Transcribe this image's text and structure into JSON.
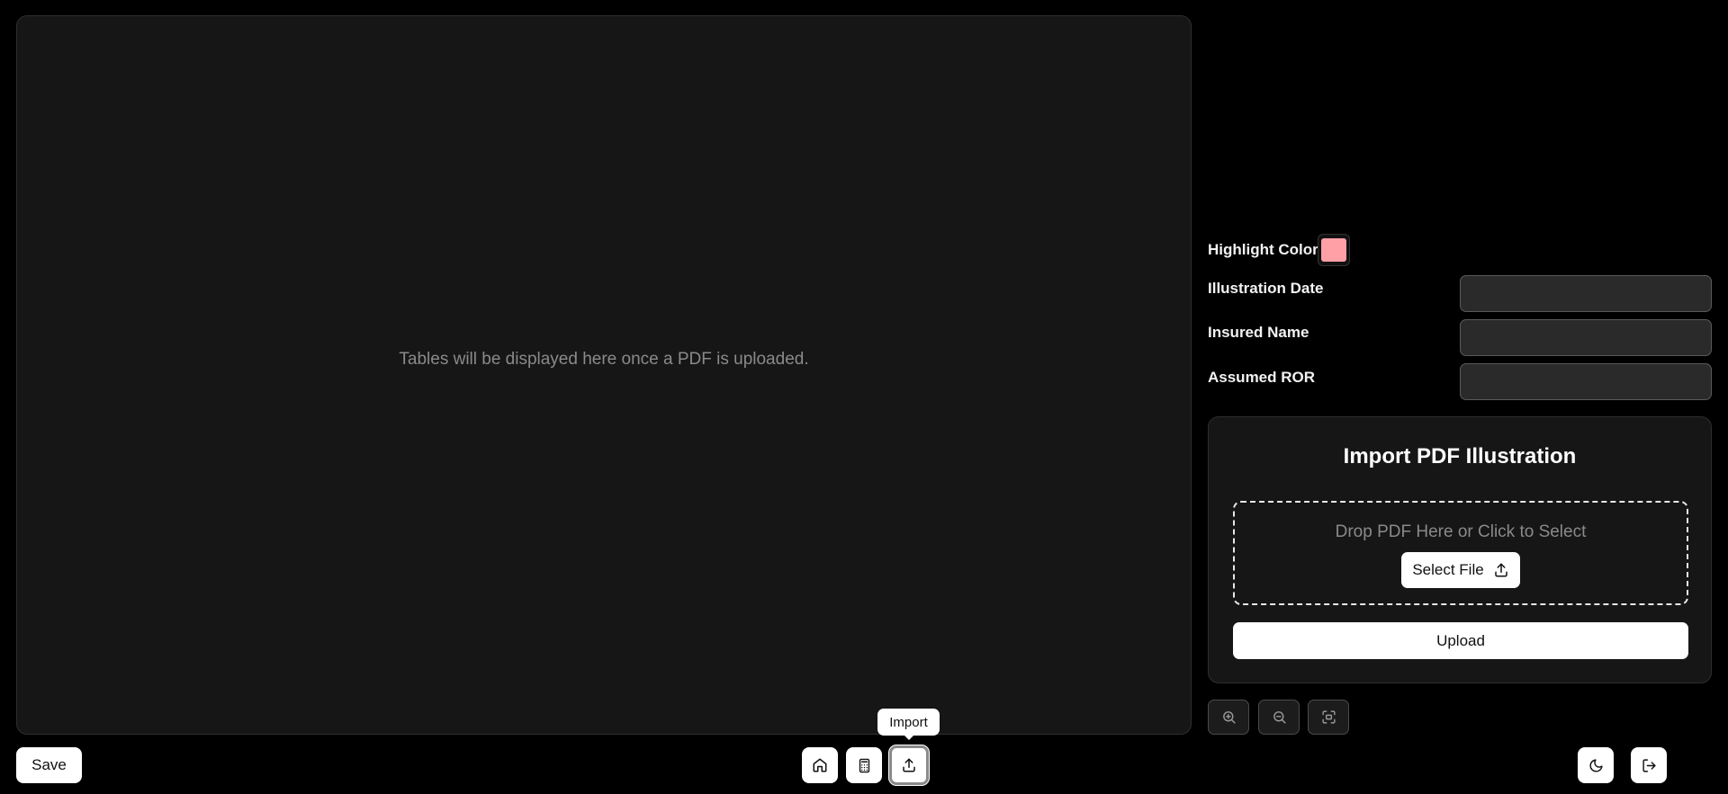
{
  "main": {
    "placeholder": "Tables will be displayed here once a PDF is uploaded."
  },
  "fields": {
    "highlight_color_label": "Highlight Color",
    "highlight_color_value": "#ff9fa6",
    "illustration_date_label": "Illustration Date",
    "illustration_date_value": "",
    "insured_name_label": "Insured Name",
    "insured_name_value": "",
    "assumed_ror_label": "Assumed ROR",
    "assumed_ror_value": ""
  },
  "import_card": {
    "title": "Import PDF Illustration",
    "drop_text": "Drop PDF Here or Click to Select",
    "select_file_label": "Select File",
    "upload_label": "Upload"
  },
  "zoom": {
    "icons": [
      "zoom-in-icon",
      "zoom-out-icon",
      "fit-screen-icon"
    ]
  },
  "toolbar": {
    "save_label": "Save",
    "tooltip": "Import",
    "nav_icons": [
      "home-icon",
      "calculator-icon",
      "upload-icon"
    ],
    "right_icons": [
      "moon-icon",
      "logout-icon"
    ]
  }
}
